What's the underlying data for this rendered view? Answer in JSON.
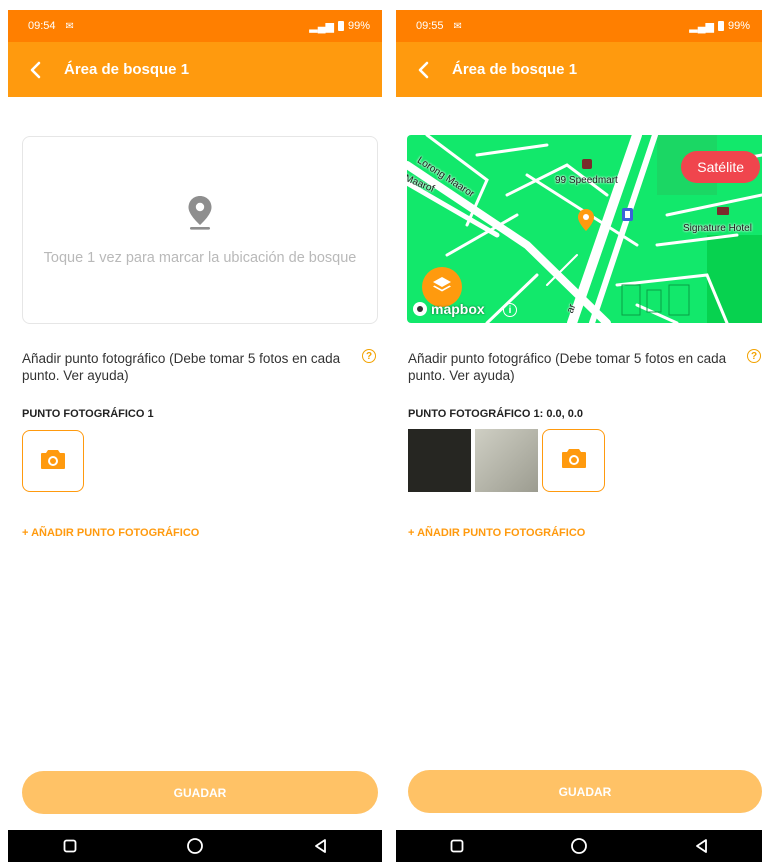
{
  "left": {
    "status": {
      "time": "09:54",
      "battery": "99%"
    },
    "appbar": {
      "title": "Área de bosque 1"
    },
    "location": {
      "hint": "Toque 1 vez para marcar la ubicación de bosque"
    },
    "add_info": "Añadir punto fotográfico (Debe tomar 5 fotos en cada punto. Ver ayuda)",
    "help_icon": "?",
    "point_title": "PUNTO FOTOGRÁFICO 1",
    "add_point_link": "+ AÑADIR PUNTO FOTOGRÁFICO",
    "save_label": "GUADAR"
  },
  "right": {
    "status": {
      "time": "09:55",
      "battery": "99%"
    },
    "appbar": {
      "title": "Área de bosque 1"
    },
    "map": {
      "satellite_label": "Satélite",
      "attribution": "mapbox",
      "info": "i",
      "labels": {
        "road1": "Lorong Maaror",
        "road2": "Maarof",
        "shop": "99 Speedmart",
        "hotel": "Signature Hotel",
        "road3": "ar"
      }
    },
    "add_info": "Añadir punto fotográfico (Debe tomar 5 fotos en cada punto. Ver ayuda)",
    "help_icon": "?",
    "point_title": "PUNTO FOTOGRÁFICO 1: 0.0, 0.0",
    "add_point_link": "+ AÑADIR PUNTO FOTOGRÁFICO",
    "save_label": "GUADAR"
  },
  "icons": {
    "back": "chevron-left-icon",
    "pin": "location-pin-icon",
    "camera": "camera-icon",
    "layers": "layers-icon",
    "nav_recent": "square-icon",
    "nav_home": "circle-icon",
    "nav_back": "triangle-icon"
  },
  "colors": {
    "status_bar": "#ff7f00",
    "app_bar": "#ff9a0e",
    "accent": "#ff9a0e",
    "save_button": "#ffc266",
    "satellite_button": "#f0454d",
    "map_green": "#12e86b"
  }
}
